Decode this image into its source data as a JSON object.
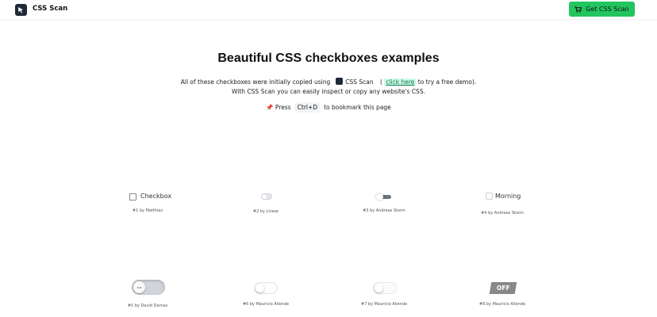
{
  "header": {
    "brand": "CSS Scan",
    "cta_label": "Get CSS Scan",
    "cta_color": "#22c55e"
  },
  "hero": {
    "title": "Beautiful CSS checkboxes examples",
    "line1_prefix": "All of these checkboxes were initially copied using",
    "line1_app": "CSS Scan",
    "line1_paren_open": "(",
    "line1_link": "click here",
    "line1_suffix": "to try a free demo).",
    "line2": "With CSS Scan you can easily inspect or copy any website's CSS.",
    "line3_icon": "📌",
    "line3_prefix": "Press",
    "line3_key": "Ctrl+D",
    "line3_suffix": "to bookmark this page"
  },
  "examples": [
    {
      "label": "Checkbox",
      "caption": "#1 by Matthias",
      "checked": false
    },
    {
      "caption": "#2 by Linear",
      "checked": false
    },
    {
      "caption": "#3 by Andreas Storm",
      "checked": false
    },
    {
      "label": "Morning",
      "caption": "#4 by Andreas Storm",
      "checked": false
    },
    {
      "caption": "#5 by David Darnes",
      "checked": false
    },
    {
      "caption": "#6 by Mauricio Allende",
      "checked": false
    },
    {
      "caption": "#7 by Mauricio Allende",
      "checked": false
    },
    {
      "label": "OFF",
      "caption": "#8 by Mauricio Allende",
      "checked": false
    }
  ],
  "icons": {
    "logo": "cursor-arrow-icon",
    "cta": "shopping-cart-icon",
    "pin": "pushpin-icon"
  }
}
